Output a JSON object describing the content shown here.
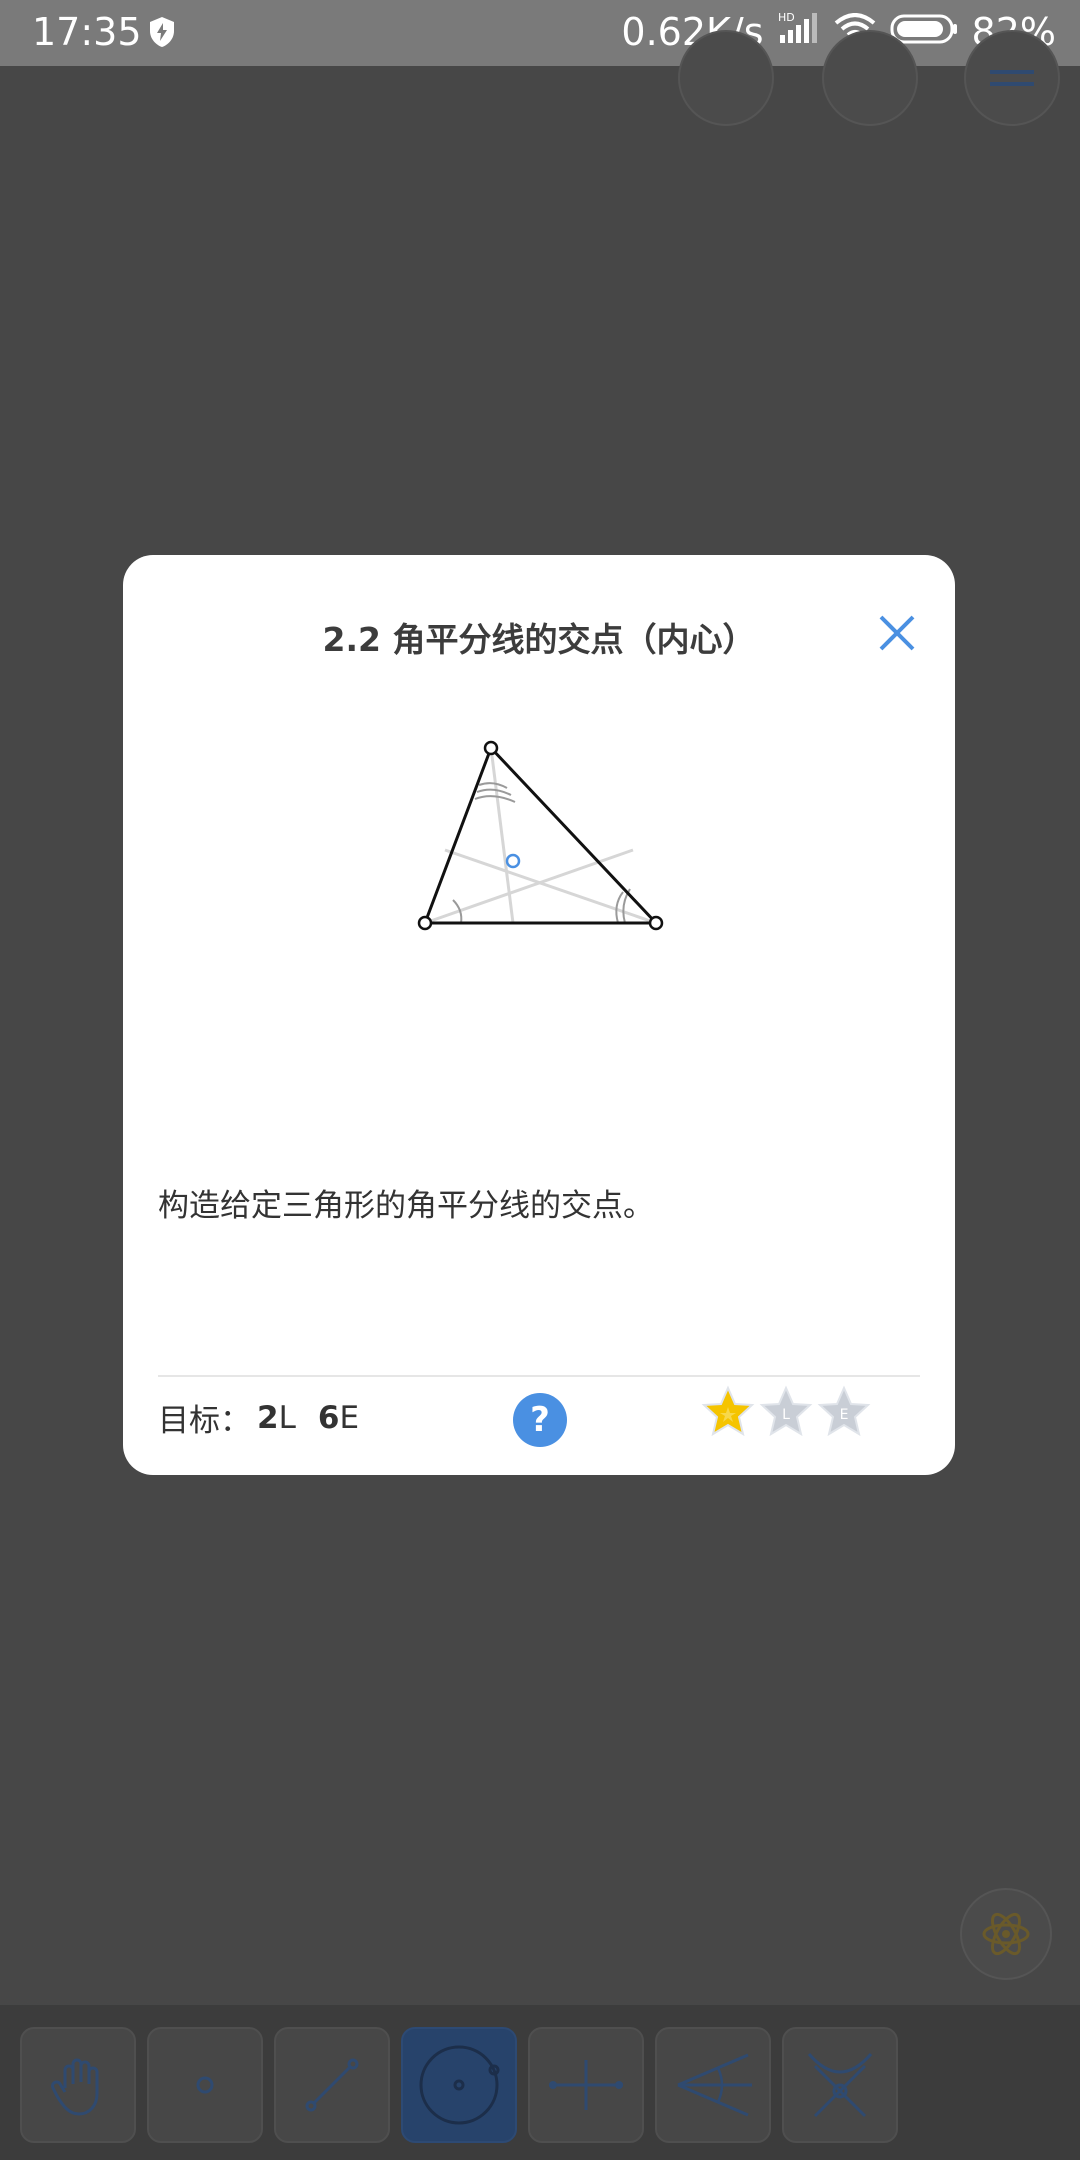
{
  "status_bar": {
    "time": "17:35",
    "net_speed": "0.62K/s",
    "network_badge": "HD",
    "battery": "82%"
  },
  "dialog": {
    "title": "2.2 角平分线的交点（内心）",
    "description": "构造给定三角形的角平分线的交点。",
    "goal_label": "目标：",
    "goal_l_value": "2",
    "goal_l_unit": "L",
    "goal_e_value": "6",
    "goal_e_unit": "E",
    "help_label": "?",
    "stars": [
      {
        "label": "",
        "earned": true
      },
      {
        "label": "L",
        "earned": false
      },
      {
        "label": "E",
        "earned": false
      }
    ]
  },
  "colors": {
    "accent": "#4a90e2",
    "star_gold": "#f5c400",
    "star_grey": "#c9ced6",
    "overlay_bg": "#474747"
  },
  "toolbar": {
    "tools": [
      {
        "name": "move",
        "icon": "hand-icon",
        "active": false
      },
      {
        "name": "point",
        "icon": "point-icon",
        "active": false
      },
      {
        "name": "line",
        "icon": "line-icon",
        "active": false
      },
      {
        "name": "circle",
        "icon": "circle-icon",
        "active": true
      },
      {
        "name": "perpendicular",
        "icon": "perpendicular-icon",
        "active": false
      },
      {
        "name": "angle-bisector",
        "icon": "angle-bisector-icon",
        "active": false
      },
      {
        "name": "intersect",
        "icon": "intersect-icon",
        "active": false
      }
    ]
  }
}
